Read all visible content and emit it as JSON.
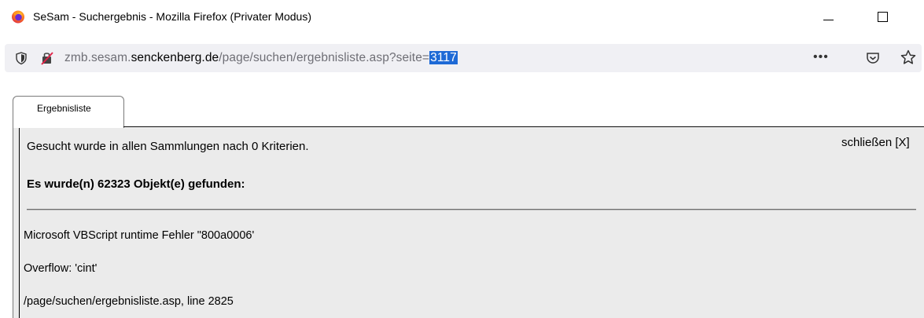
{
  "window": {
    "title": "SeSam - Suchergebnis - Mozilla Firefox (Privater Modus)"
  },
  "urlbar": {
    "url_prefix": "zmb.sesam.",
    "url_host": "senckenberg.de",
    "url_path": "/page/suchen/ergebnisliste.asp?seite=",
    "url_selected": "3117",
    "more_label": "•••"
  },
  "page": {
    "tab_label": "Ergebnisliste",
    "search_info": "Gesucht wurde in allen Sammlungen nach 0 Kriterien.",
    "close_label": "schließen [X]",
    "result_count": "Es wurde(n) 62323 Objekt(e) gefunden:",
    "errors": [
      "Microsoft VBScript runtime Fehler \"800a0006'",
      "Overflow: 'cint'",
      "/page/suchen/ergebnisliste.asp, line 2825"
    ]
  },
  "colors": {
    "selection": "#1e6ad6",
    "panel_bg": "#ebebeb",
    "urlbar_bg": "#f0f0f4"
  }
}
